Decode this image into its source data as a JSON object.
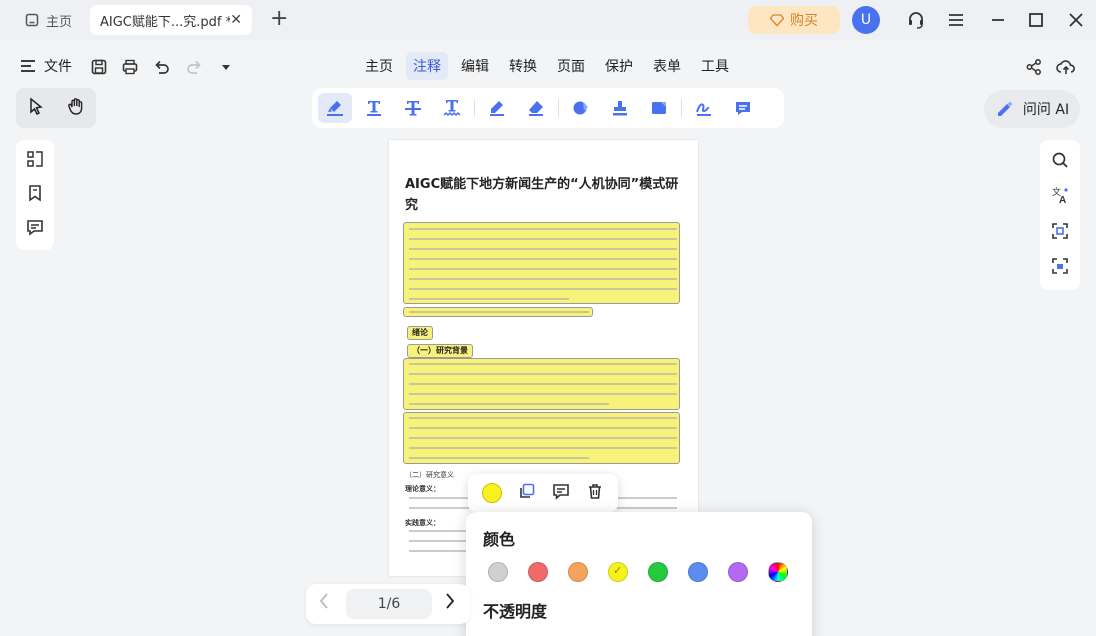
{
  "tabs": {
    "home_label": "主页",
    "doc_title": "AIGC赋能下...究.pdf *",
    "close_glyph": "✕",
    "new_tab_glyph": "+"
  },
  "titlebar": {
    "buy_label": "购买",
    "avatar_letter": "U"
  },
  "menubar": {
    "file_label": "文件",
    "items": [
      "主页",
      "注释",
      "编辑",
      "转换",
      "页面",
      "保护",
      "表单",
      "工具"
    ],
    "active_index": 1
  },
  "ai_button": {
    "label": "问问 AI"
  },
  "document": {
    "title": "AIGC赋能下地方新闻生产的“人机协同”模式研究",
    "section_intro": "绪论",
    "section_background": "（一）研究背景",
    "section_significance": "（二）研究意义",
    "para_theory": "理论意义：",
    "para_practice": "实践意义："
  },
  "popover": {
    "color_heading": "颜色",
    "opacity_heading": "不透明度",
    "colors": [
      "#d0d0d0",
      "#f06a6a",
      "#f5a35c",
      "#f7f21e",
      "#27c93f",
      "#5b8def",
      "#b26af0"
    ],
    "selected_color_index": 3
  },
  "pager": {
    "page_indicator": "1/6"
  },
  "accent_color": "#3b5bd9",
  "highlight_color": "#f7f27a"
}
